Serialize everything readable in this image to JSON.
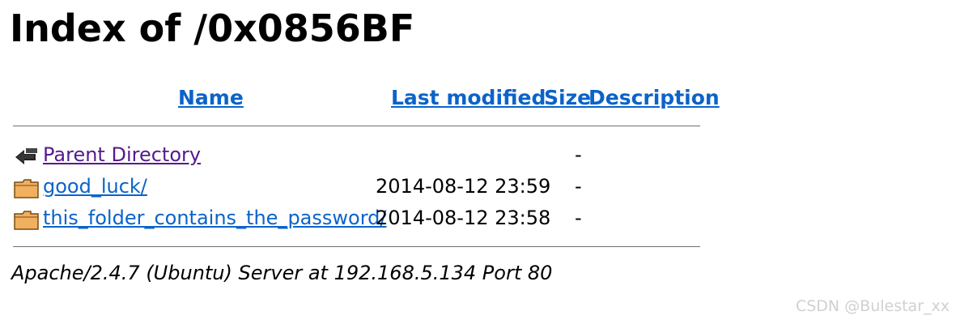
{
  "page": {
    "title": "Index of /0x0856BF"
  },
  "table": {
    "headers": {
      "name": "Name",
      "last_modified": "Last modified",
      "size": "Size",
      "description": "Description"
    },
    "rows": [
      {
        "icon": "back-icon",
        "name": "Parent Directory",
        "modified": "",
        "size": "-"
      },
      {
        "icon": "folder-icon",
        "name": "good_luck/",
        "modified": "2014-08-12 23:59",
        "size": "-"
      },
      {
        "icon": "folder-icon",
        "name": "this_folder_contains_the_password/",
        "modified": "2014-08-12 23:58",
        "size": "-"
      }
    ]
  },
  "footer": {
    "server": "Apache/2.4.7 (Ubuntu) Server at 192.168.5.134 Port 80"
  },
  "watermark": "CSDN @Bulestar_xx",
  "colors": {
    "link": "#0b63c9",
    "visited": "#551a8b",
    "folder": "#f0b060"
  }
}
